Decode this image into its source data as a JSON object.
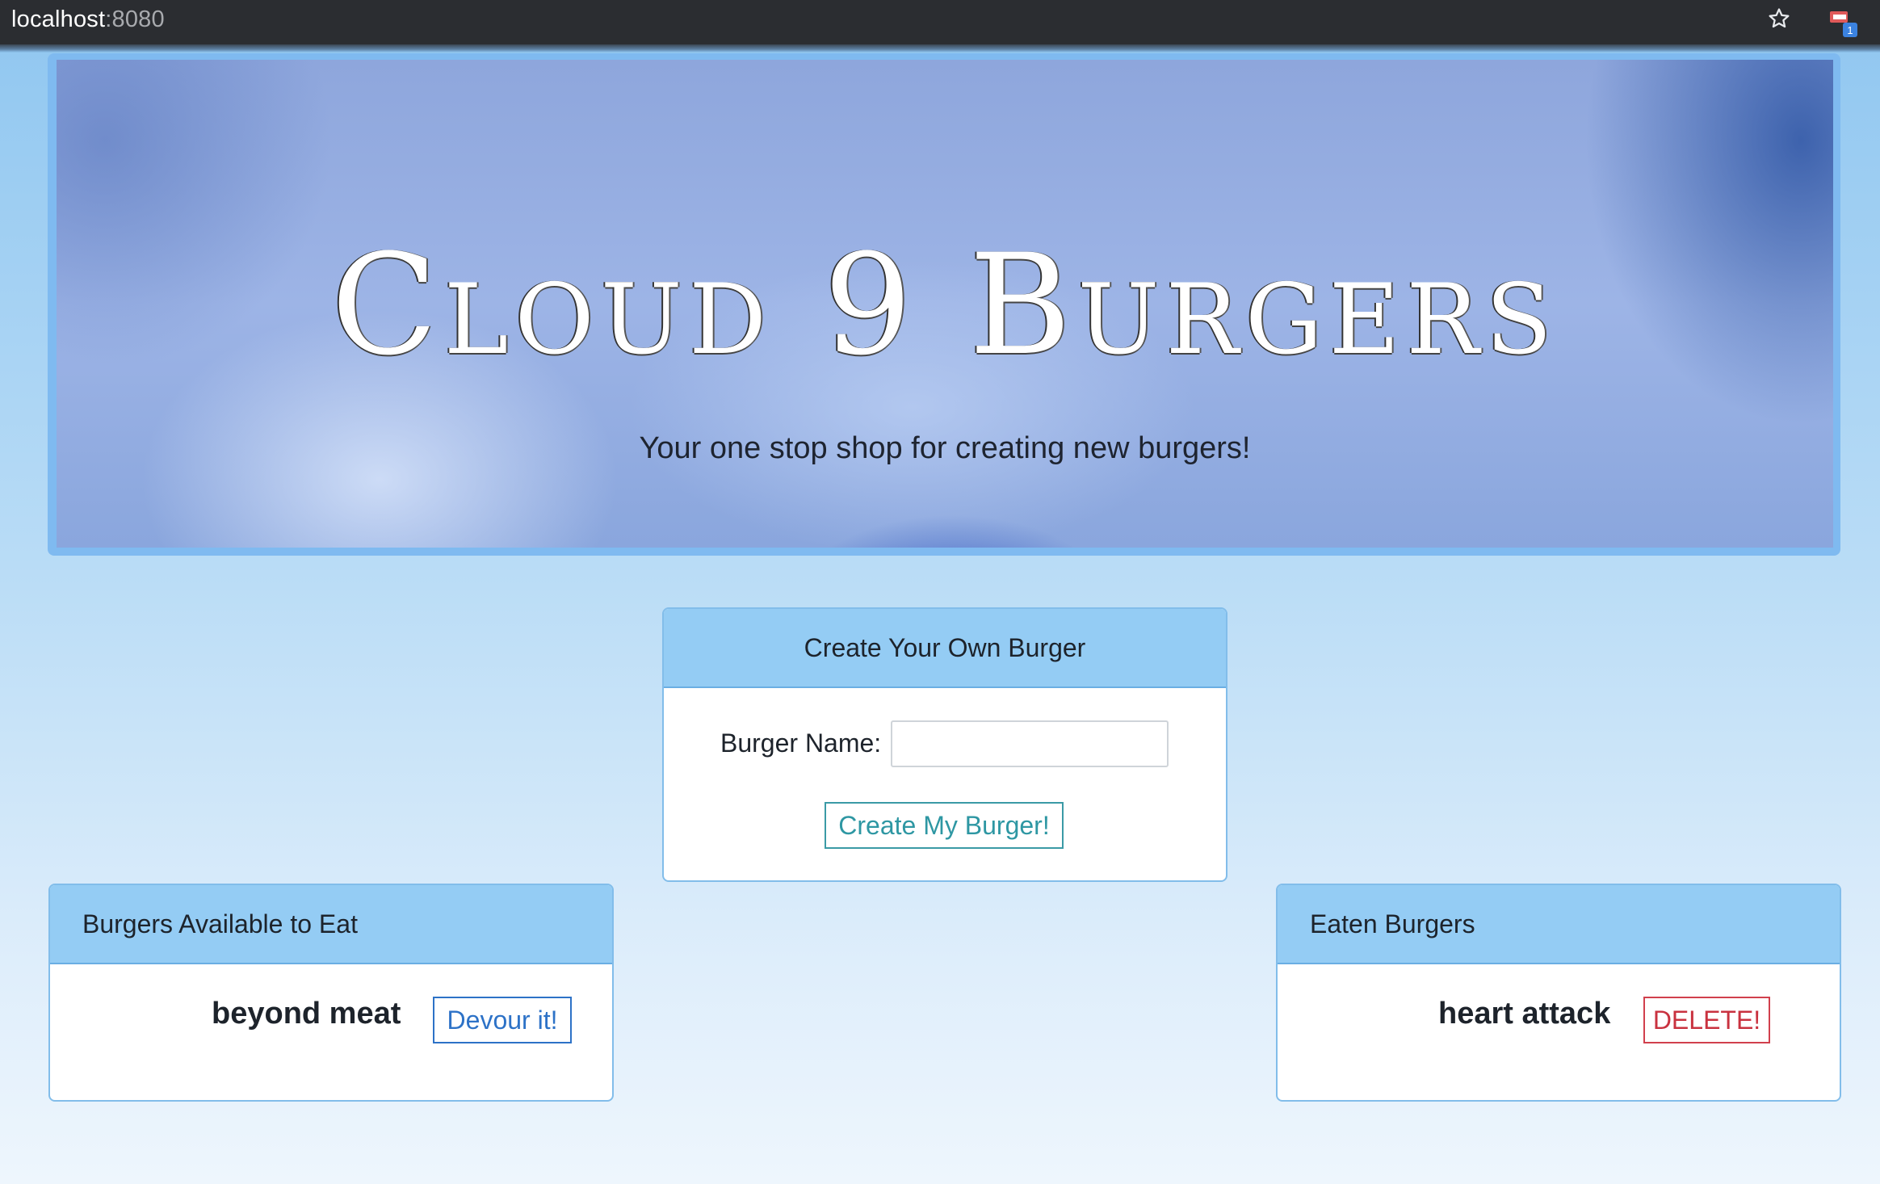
{
  "browser": {
    "url_host": "localhost",
    "url_port": ":8080",
    "icons": [
      "star-icon",
      "extension-icon"
    ],
    "extension_badge": "1"
  },
  "hero": {
    "title": "Cloud 9 Burgers",
    "subtitle": "Your one stop shop for creating new burgers!"
  },
  "create": {
    "header": "Create Your Own Burger",
    "name_label": "Burger Name:",
    "name_value": "",
    "submit_label": "Create My Burger!"
  },
  "available": {
    "header": "Burgers Available to Eat",
    "items": [
      {
        "name": "beyond meat",
        "action_label": "Devour it!"
      }
    ]
  },
  "eaten": {
    "header": "Eaten Burgers",
    "items": [
      {
        "name": "heart attack",
        "action_label": "DELETE!"
      }
    ]
  },
  "colors": {
    "header_bg": "#94ccf4",
    "devour": "#2d72c7",
    "delete": "#c9323f",
    "create": "#2e97a3"
  }
}
